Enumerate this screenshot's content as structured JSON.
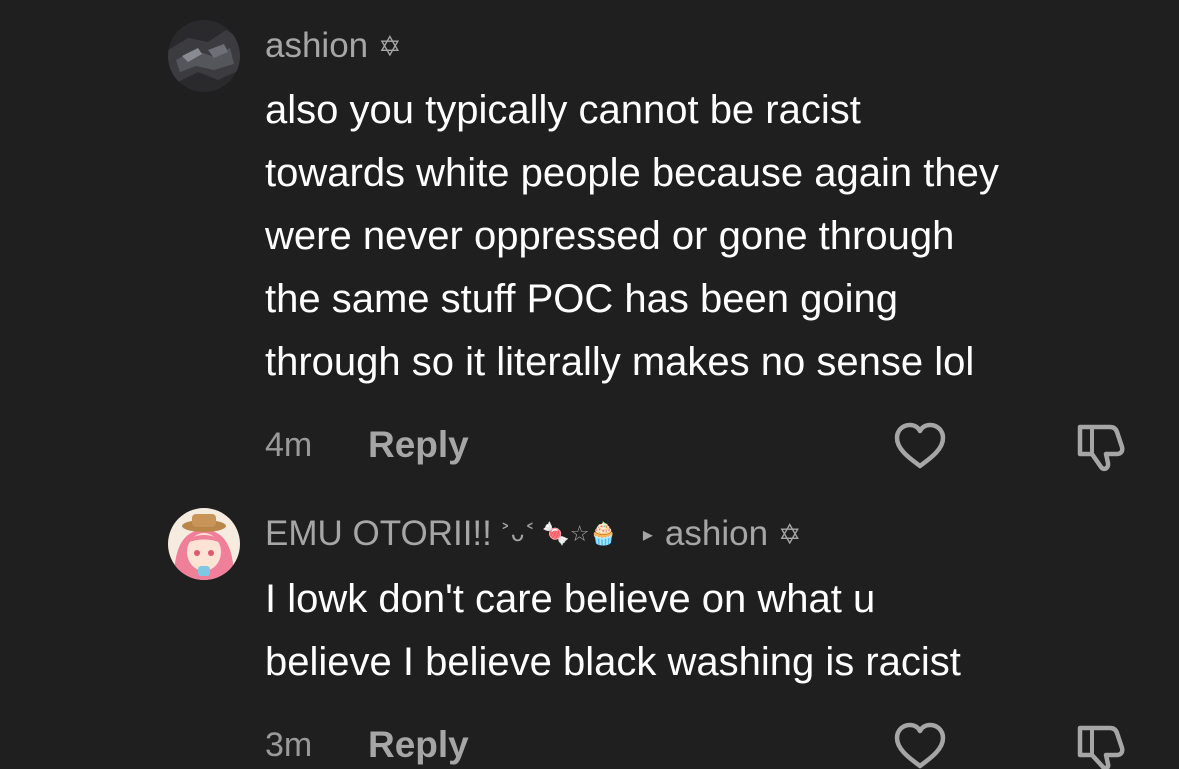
{
  "comments": [
    {
      "username": "ashion",
      "username_glyph": "✡",
      "body_lines": [
        "also you typically cannot be racist",
        "towards white people because again they",
        "were never oppressed or gone through",
        "the same stuff POC has been going",
        "through so it literally makes no sense lol"
      ],
      "timestamp": "4m",
      "reply_label": "Reply"
    },
    {
      "username": "EMU OTORII!!",
      "username_decor": "˃ᴗ˂ 🍬☆🧁",
      "reply_arrow": "▸",
      "reply_to": "ashion",
      "reply_to_glyph": "✡",
      "body_lines": [
        "I lowk don't care believe on what u",
        "believe I believe black washing is racist"
      ],
      "timestamp": "3m",
      "reply_label": "Reply"
    }
  ],
  "colors": {
    "background": "#1f1f1f",
    "username": "#a6a6a6",
    "body_text": "#ffffff",
    "meta": "#9a9a9a",
    "icon": "#a6a6a6"
  },
  "icons": {
    "like": "heart-icon",
    "dislike": "thumbs-down-icon"
  }
}
